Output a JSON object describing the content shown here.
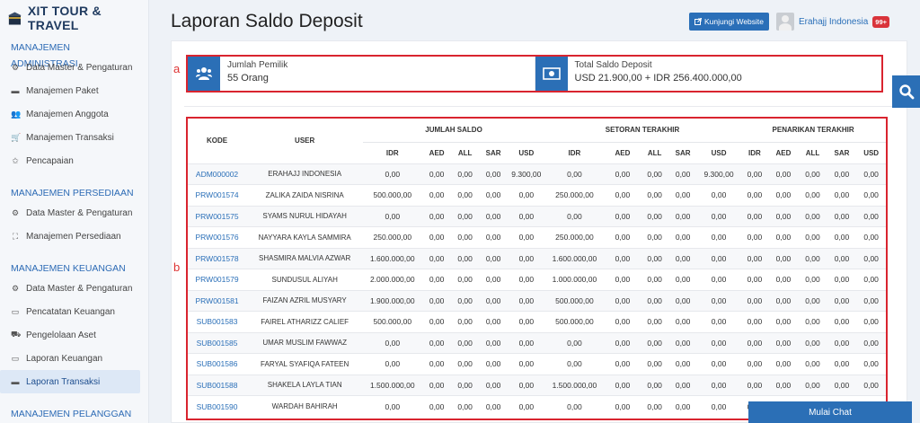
{
  "brand": {
    "title": "XIT TOUR & TRAVEL"
  },
  "sidebar": {
    "sections": [
      {
        "title": "MANAJEMEN ADMINISTRASI",
        "items": [
          {
            "label": "Data Master & Pengaturan",
            "icon": "gears-icon"
          },
          {
            "label": "Manajemen Paket",
            "icon": "book-icon"
          },
          {
            "label": "Manajemen Anggota",
            "icon": "users-icon"
          },
          {
            "label": "Manajemen Transaksi",
            "icon": "cart-icon"
          },
          {
            "label": "Pencapaian",
            "icon": "trophy-icon"
          }
        ]
      },
      {
        "title": "MANAJEMEN PERSEDIAAN",
        "items": [
          {
            "label": "Data Master & Pengaturan",
            "icon": "gears-icon"
          },
          {
            "label": "Manajemen Persediaan",
            "icon": "cubes-icon"
          }
        ]
      },
      {
        "title": "MANAJEMEN KEUANGAN",
        "items": [
          {
            "label": "Data Master & Pengaturan",
            "icon": "gears-icon"
          },
          {
            "label": "Pencatatan Keuangan",
            "icon": "money-icon"
          },
          {
            "label": "Pengelolaan Aset",
            "icon": "car-icon"
          },
          {
            "label": "Laporan Keuangan",
            "icon": "money-icon"
          },
          {
            "label": "Laporan Transaksi",
            "icon": "book-icon",
            "active": true
          }
        ]
      },
      {
        "title": "MANAJEMEN PELANGGAN",
        "items": []
      }
    ]
  },
  "header": {
    "title": "Laporan Saldo Deposit",
    "visit_label": "Kunjungi Website",
    "user_name": "Erahajj Indonesia",
    "notif_count": "99+"
  },
  "annotations": {
    "a": "a",
    "b": "b"
  },
  "summary": {
    "owners_label": "Jumlah Pemilik",
    "owners_value": "55 Orang",
    "total_label": "Total Saldo Deposit",
    "total_value": "USD 21.900,00 + IDR 256.400.000,00"
  },
  "table": {
    "col_kode": "KODE",
    "col_user": "USER",
    "group_saldo": "JUMLAH SALDO",
    "group_setoran": "SETORAN TERAKHIR",
    "group_penarikan": "PENARIKAN TERAKHIR",
    "currencies": [
      "IDR",
      "AED",
      "ALL",
      "SAR",
      "USD"
    ],
    "rows": [
      [
        "ADM000002",
        "ERAHAJJ INDONESIA",
        "0,00",
        "0,00",
        "0,00",
        "0,00",
        "9.300,00",
        "0,00",
        "0,00",
        "0,00",
        "0,00",
        "9.300,00",
        "0,00",
        "0,00",
        "0,00",
        "0,00",
        "0,00"
      ],
      [
        "PRW001574",
        "ZALIKA ZAIDA NISRINA",
        "500.000,00",
        "0,00",
        "0,00",
        "0,00",
        "0,00",
        "250.000,00",
        "0,00",
        "0,00",
        "0,00",
        "0,00",
        "0,00",
        "0,00",
        "0,00",
        "0,00",
        "0,00"
      ],
      [
        "PRW001575",
        "SYAMS NURUL HIDAYAH",
        "0,00",
        "0,00",
        "0,00",
        "0,00",
        "0,00",
        "0,00",
        "0,00",
        "0,00",
        "0,00",
        "0,00",
        "0,00",
        "0,00",
        "0,00",
        "0,00",
        "0,00"
      ],
      [
        "PRW001576",
        "NAYYARA KAYLA SAMMIRA",
        "250.000,00",
        "0,00",
        "0,00",
        "0,00",
        "0,00",
        "250.000,00",
        "0,00",
        "0,00",
        "0,00",
        "0,00",
        "0,00",
        "0,00",
        "0,00",
        "0,00",
        "0,00"
      ],
      [
        "PRW001578",
        "SHASMIRA MALVIA AZWAR",
        "1.600.000,00",
        "0,00",
        "0,00",
        "0,00",
        "0,00",
        "1.600.000,00",
        "0,00",
        "0,00",
        "0,00",
        "0,00",
        "0,00",
        "0,00",
        "0,00",
        "0,00",
        "0,00"
      ],
      [
        "PRW001579",
        "SUNDUSUL ALIYAH",
        "2.000.000,00",
        "0,00",
        "0,00",
        "0,00",
        "0,00",
        "1.000.000,00",
        "0,00",
        "0,00",
        "0,00",
        "0,00",
        "0,00",
        "0,00",
        "0,00",
        "0,00",
        "0,00"
      ],
      [
        "PRW001581",
        "FAIZAN AZRIL MUSYARY",
        "1.900.000,00",
        "0,00",
        "0,00",
        "0,00",
        "0,00",
        "500.000,00",
        "0,00",
        "0,00",
        "0,00",
        "0,00",
        "0,00",
        "0,00",
        "0,00",
        "0,00",
        "0,00"
      ],
      [
        "SUB001583",
        "FAIREL ATHARIZZ CALIEF",
        "500.000,00",
        "0,00",
        "0,00",
        "0,00",
        "0,00",
        "500.000,00",
        "0,00",
        "0,00",
        "0,00",
        "0,00",
        "0,00",
        "0,00",
        "0,00",
        "0,00",
        "0,00"
      ],
      [
        "SUB001585",
        "UMAR MUSLIM FAWWAZ",
        "0,00",
        "0,00",
        "0,00",
        "0,00",
        "0,00",
        "0,00",
        "0,00",
        "0,00",
        "0,00",
        "0,00",
        "0,00",
        "0,00",
        "0,00",
        "0,00",
        "0,00"
      ],
      [
        "SUB001586",
        "FARYAL SYAFIQA FATEEN",
        "0,00",
        "0,00",
        "0,00",
        "0,00",
        "0,00",
        "0,00",
        "0,00",
        "0,00",
        "0,00",
        "0,00",
        "0,00",
        "0,00",
        "0,00",
        "0,00",
        "0,00"
      ],
      [
        "SUB001588",
        "SHAKELA LAYLA TIAN",
        "1.500.000,00",
        "0,00",
        "0,00",
        "0,00",
        "0,00",
        "1.500.000,00",
        "0,00",
        "0,00",
        "0,00",
        "0,00",
        "0,00",
        "0,00",
        "0,00",
        "0,00",
        "0,00"
      ],
      [
        "SUB001590",
        "WARDAH BAHIRAH",
        "0,00",
        "0,00",
        "0,00",
        "0,00",
        "0,00",
        "0,00",
        "0,00",
        "0,00",
        "0,00",
        "0,00",
        "0,00",
        "0,00",
        "0,00",
        "0,00",
        "0,00"
      ]
    ]
  },
  "chat": {
    "label": "Mulai Chat"
  },
  "colors": {
    "accent": "#2b6fb6",
    "annotation": "#d9242f"
  }
}
